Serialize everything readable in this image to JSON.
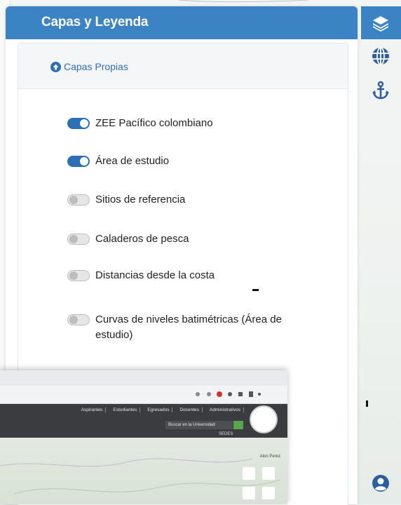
{
  "panel": {
    "title": "Capas y Leyenda",
    "section_link": "Capas Propias"
  },
  "layers": [
    {
      "label": "ZEE Pacífico colombiano",
      "enabled": true
    },
    {
      "label": "Área de estudio",
      "enabled": true
    },
    {
      "label": "Sitios de referencia",
      "enabled": false
    },
    {
      "label": "Caladeros de pesca",
      "enabled": false
    },
    {
      "label": "Distancias desde la costa",
      "enabled": false
    },
    {
      "label": "Curvas de niveles batimétricas (Área de estudio)",
      "enabled": false
    }
  ],
  "right_rail": {
    "icons": [
      "layers-icon",
      "globe-icon",
      "anchor-icon",
      "user-icon"
    ]
  },
  "embedded_screenshot": {
    "nav_links": [
      "Aspirantes",
      "Estudiantes",
      "Egresados",
      "Docentes",
      "Administrativos"
    ],
    "search_placeholder": "Buscar en la Universidad",
    "sedes_label": "SEDES",
    "user_label": "Alon Perez"
  },
  "colors": {
    "header": "#3b83c3",
    "accent": "#2d6fb5",
    "link": "#2f6fb3"
  }
}
